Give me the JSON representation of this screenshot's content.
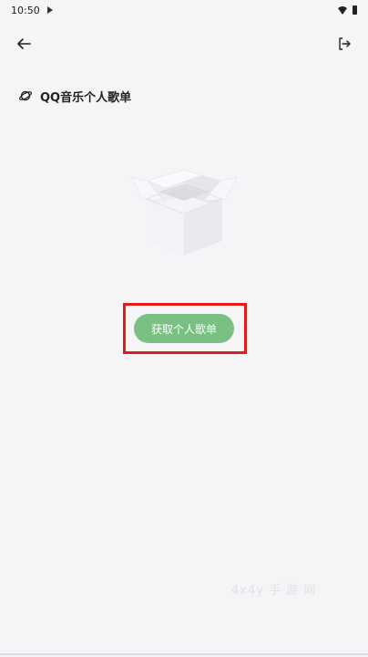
{
  "status_bar": {
    "time": "10:50"
  },
  "section": {
    "title": "QQ音乐个人歌单"
  },
  "fetch_button": {
    "label": "获取个人歌单"
  },
  "watermark": {
    "text": "4x4y 手 游 网"
  },
  "colors": {
    "accent": "#7ac082",
    "highlight": "#e21b1b",
    "background": "#f5f5f7"
  },
  "icons": {
    "back": "arrow-left",
    "logout": "exit",
    "section": "planet",
    "illustration": "empty-box"
  }
}
